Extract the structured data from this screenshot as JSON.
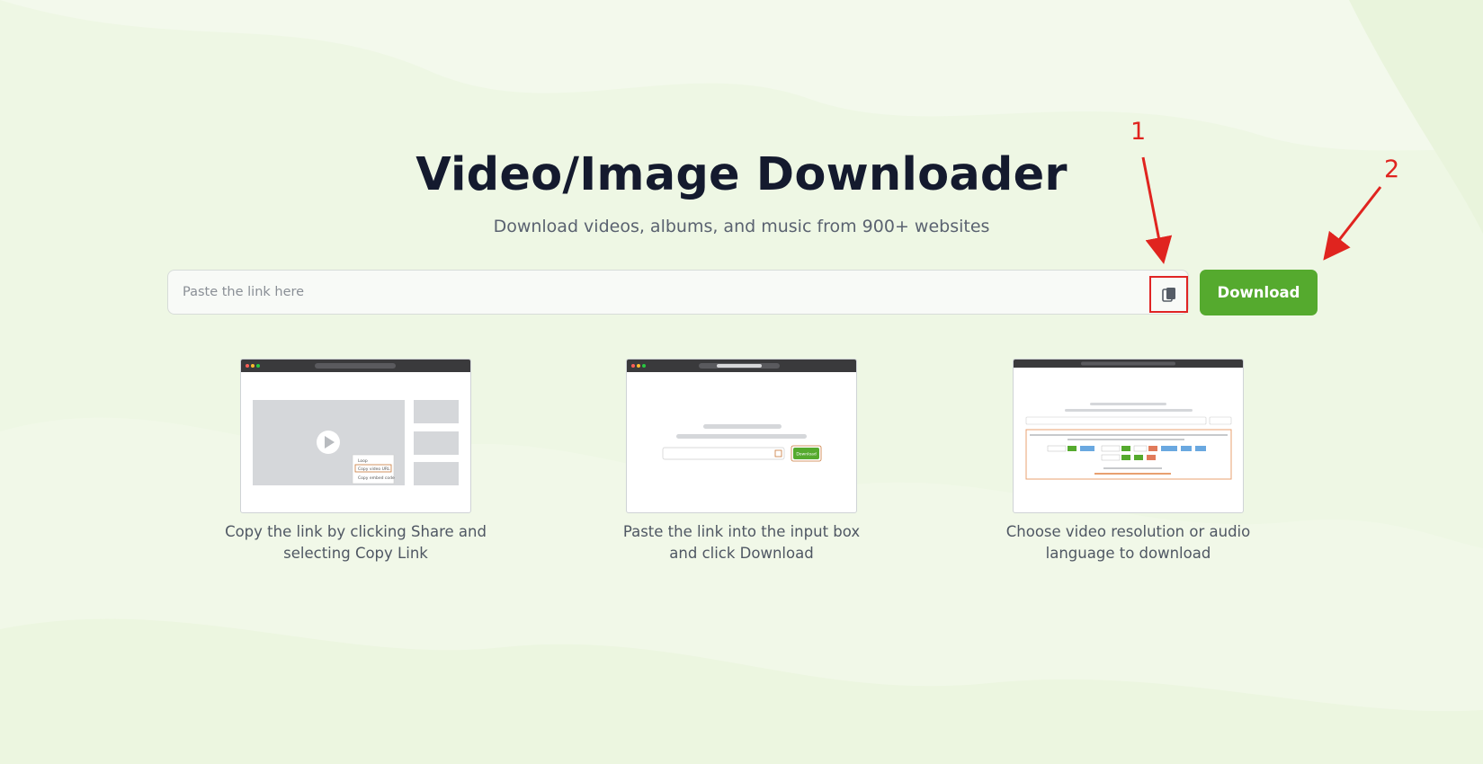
{
  "header": {
    "title": "Video/Image Downloader",
    "subtitle": "Download videos, albums, and music from 900+ websites"
  },
  "search": {
    "placeholder": "Paste the link here",
    "value": "",
    "paste_icon": "clipboard-paste-icon",
    "download_label": "Download"
  },
  "annotations": {
    "marker_1": "1",
    "marker_2": "2",
    "color": "#e0241f"
  },
  "steps": [
    {
      "caption": "Copy the link by clicking Share and selecting Copy Link",
      "illustration": {
        "menu_items": [
          "Loop",
          "Copy video URL",
          "Copy embed code"
        ]
      }
    },
    {
      "caption": "Paste the link into the input box and click Download",
      "illustration": {
        "button_label": "Download"
      }
    },
    {
      "caption": "Choose video resolution or audio language to download",
      "illustration": {}
    }
  ],
  "colors": {
    "accent": "#55aa2e",
    "title": "#141a2e",
    "background": "#eef7e4"
  }
}
